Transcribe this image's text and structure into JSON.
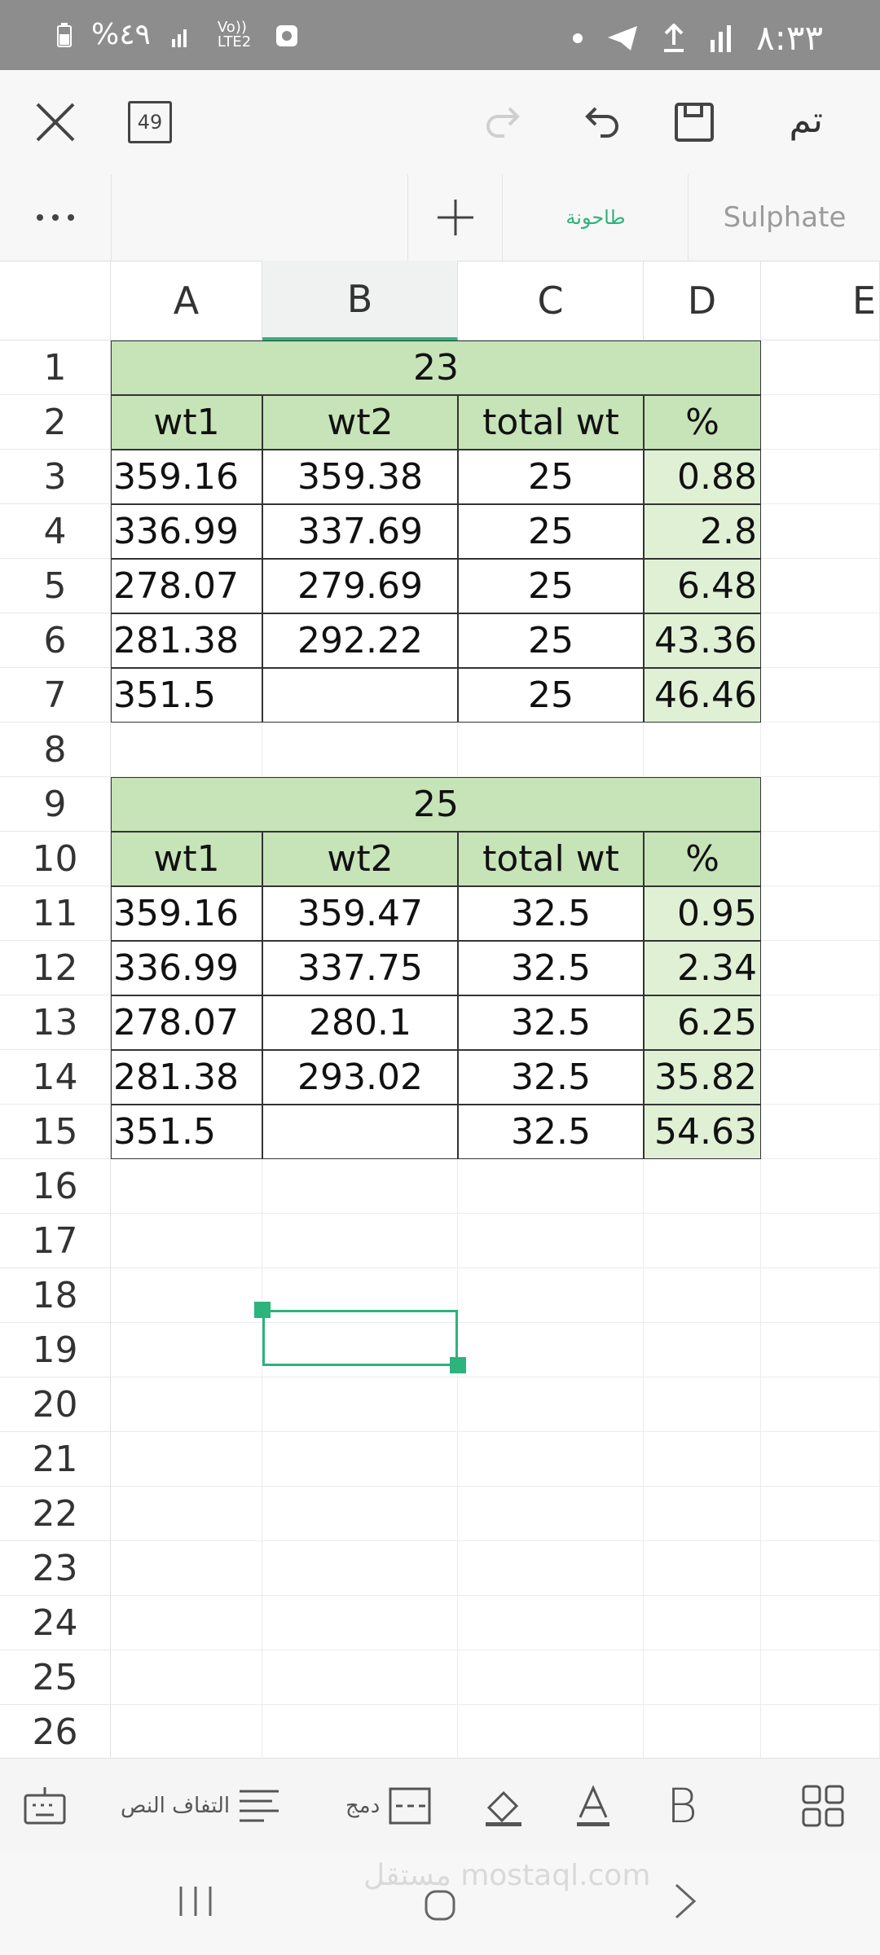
{
  "status_bar": {
    "battery": "%٤٩",
    "network": "Vo)) LTE2",
    "time": "٨:٣٣"
  },
  "toolbar": {
    "done_label": "تم",
    "counter": "49"
  },
  "sheet_tabs": [
    {
      "label": "طاحونة",
      "active": true
    },
    {
      "label": "Sulphate",
      "active": false
    }
  ],
  "columns": [
    "A",
    "B",
    "C",
    "D",
    "E"
  ],
  "rows": [
    "1",
    "2",
    "3",
    "4",
    "5",
    "6",
    "7",
    "8",
    "9",
    "10",
    "11",
    "12",
    "13",
    "14",
    "15",
    "16",
    "17",
    "18",
    "19",
    "20",
    "21",
    "22",
    "23",
    "24",
    "25",
    "26"
  ],
  "table1": {
    "title": "23",
    "headers": [
      "wt1",
      "wt2",
      "total wt",
      "%"
    ],
    "rows": [
      [
        "359.16",
        "359.38",
        "25",
        "0.88"
      ],
      [
        "336.99",
        "337.69",
        "25",
        "2.8"
      ],
      [
        "278.07",
        "279.69",
        "25",
        "6.48"
      ],
      [
        "281.38",
        "292.22",
        "25",
        "43.36"
      ],
      [
        "351.5",
        "",
        "25",
        "46.46"
      ]
    ]
  },
  "table2": {
    "title": "25",
    "headers": [
      "wt1",
      "wt2",
      "total wt",
      "%"
    ],
    "rows": [
      [
        "359.16",
        "359.47",
        "32.5",
        "0.95"
      ],
      [
        "336.99",
        "337.75",
        "32.5",
        "2.34"
      ],
      [
        "278.07",
        "280.1",
        "32.5",
        "6.25"
      ],
      [
        "281.38",
        "293.02",
        "32.5",
        "35.82"
      ],
      [
        "351.5",
        "",
        "32.5",
        "54.63"
      ]
    ]
  },
  "bottom_toolbar": {
    "wrap_text": "التفاف النص",
    "merge": "دمج"
  },
  "watermark": "مستقل mostaql.com",
  "colors": {
    "accent": "#2db37c",
    "header_fill": "#c7e3b8",
    "percent_fill": "#dff0d5"
  }
}
